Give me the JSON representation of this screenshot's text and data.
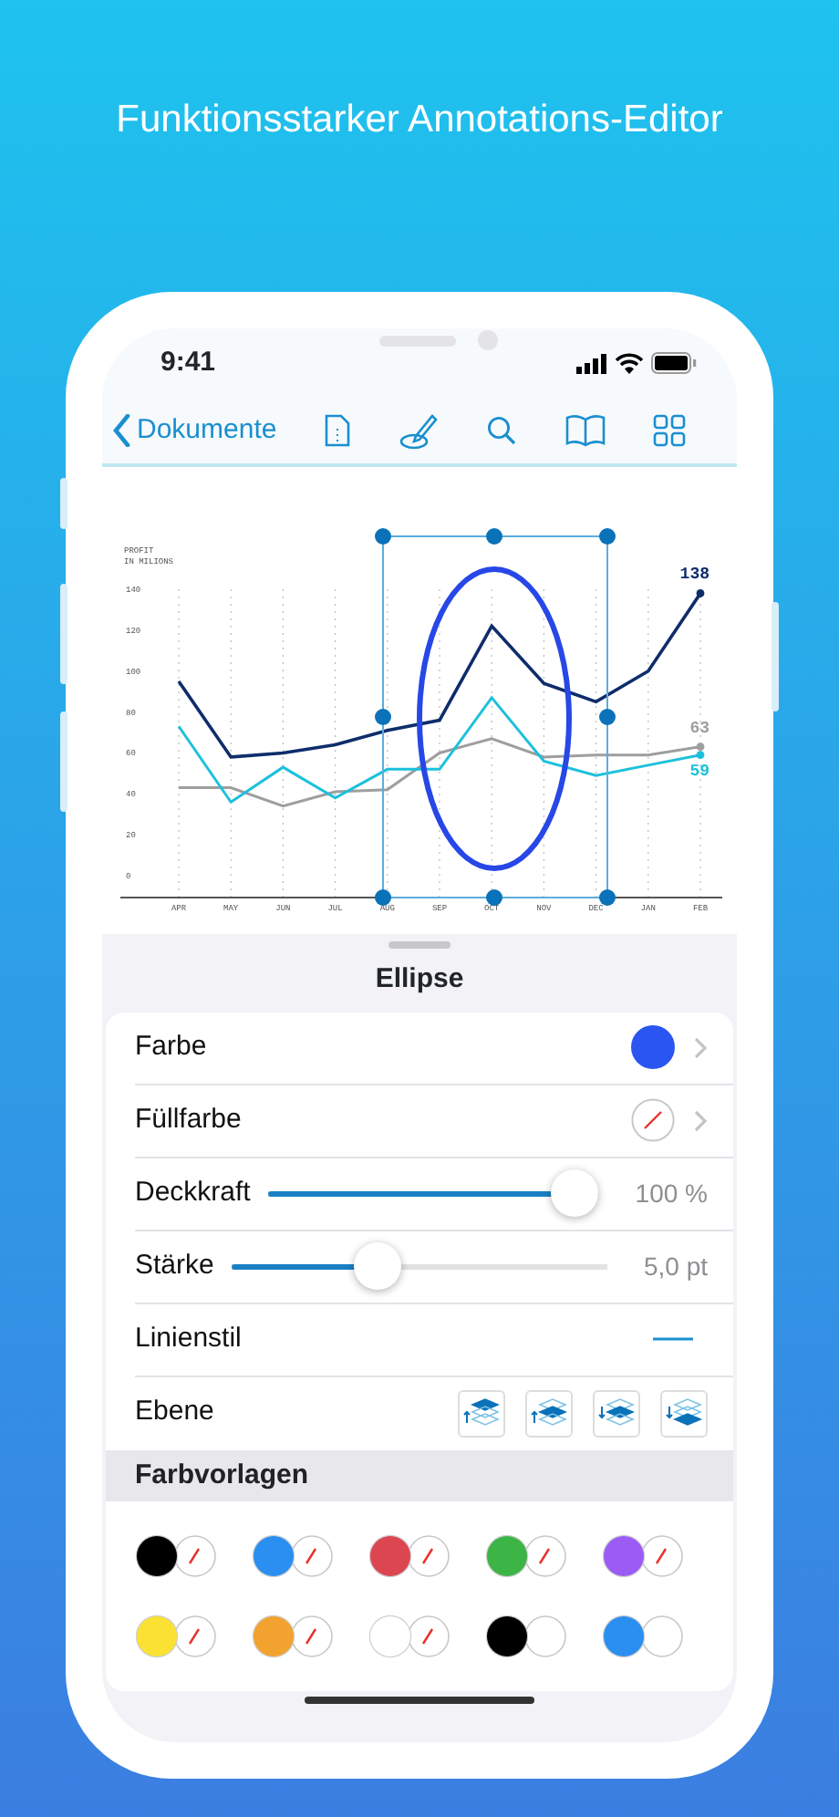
{
  "headline": "Funktionsstarker Annotations-Editor",
  "status_bar": {
    "time": "9:41"
  },
  "nav_bar": {
    "back": "Dokumente"
  },
  "chart_data": {
    "type": "line",
    "ylabel": "PROFIT IN MILIONS",
    "categories": [
      "APR",
      "MAY",
      "JUN",
      "JUL",
      "AUG",
      "SEP",
      "OCT",
      "NOV",
      "DEC",
      "JAN",
      "FEB"
    ],
    "ylim": [
      0,
      140
    ],
    "yticks": [
      0,
      20,
      40,
      60,
      80,
      100,
      120,
      140
    ],
    "grid": true,
    "series": [
      {
        "color": "#0f2d6b",
        "values": [
          95,
          58,
          60,
          64,
          71,
          76,
          122,
          94,
          85,
          100,
          138
        ]
      },
      {
        "color": "#9e9e9e",
        "values": [
          43,
          43,
          34,
          41,
          42,
          60,
          67,
          58,
          59,
          59,
          63
        ]
      },
      {
        "color": "#1cc0dc",
        "values": [
          73,
          36,
          53,
          38,
          52,
          52,
          87,
          56,
          49,
          54,
          59
        ]
      }
    ],
    "annotations": [
      {
        "text": "138",
        "x": "FEB",
        "y": 138
      },
      {
        "text": "63",
        "x": "FEB",
        "y": 63
      },
      {
        "text": "59",
        "x": "FEB",
        "y": 59
      }
    ]
  },
  "sheet": {
    "title": "Ellipse",
    "rows": [
      {
        "kind": "color",
        "label": "Farbe",
        "color": "#2a55f0"
      },
      {
        "kind": "fill",
        "label": "Füllfarbe"
      },
      {
        "kind": "slider",
        "label": "Deckkraft",
        "level": 1,
        "reading": "100 %"
      },
      {
        "kind": "slider",
        "label": "Stärke",
        "level": 0.37,
        "reading": "5,0 pt"
      },
      {
        "kind": "linestyle",
        "label": "Linienstil"
      },
      {
        "kind": "layers",
        "label": "Ebene"
      }
    ],
    "presets_title": "Farbvorlagen",
    "presets": [
      {
        "kind": "nofill",
        "color": "#000000"
      },
      {
        "kind": "nofill",
        "color": "#2a8ff0"
      },
      {
        "kind": "nofill",
        "color": "#dc4650"
      },
      {
        "kind": "nofill",
        "color": "#3cb446"
      },
      {
        "kind": "nofill",
        "color": "#9b5cf5"
      },
      {
        "kind": "nofill",
        "color": "#fbe232"
      },
      {
        "kind": "nofill",
        "color": "#f2a22e"
      },
      {
        "kind": "nofill",
        "color": "#ffffff"
      },
      {
        "kind": "whitefill",
        "color": "#000000"
      },
      {
        "kind": "whitefill",
        "color": "#2a8ff0"
      }
    ]
  }
}
